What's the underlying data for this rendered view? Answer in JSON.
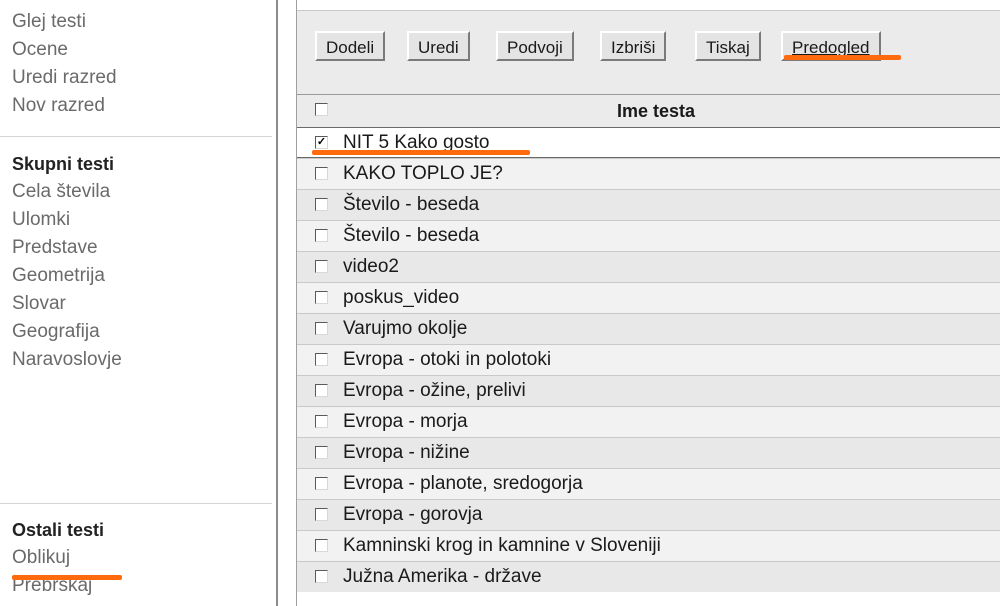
{
  "sidebar": {
    "top_links": [
      "Glej testi",
      "Ocene",
      "Uredi razred",
      "Nov razred"
    ],
    "groups": [
      {
        "heading": "Skupni testi",
        "links": [
          "Cela števila",
          "Ulomki",
          "Predstave",
          "Geometrija",
          "Slovar",
          "Geografija",
          "Naravoslovje"
        ]
      },
      {
        "heading": "Ostali testi",
        "links": [
          "Oblikuj",
          "Prebrskaj"
        ]
      }
    ]
  },
  "toolbar": {
    "buttons": [
      "Dodeli",
      "Uredi",
      "Podvoji",
      "Izbriši",
      "Tiskaj",
      "Predogled"
    ]
  },
  "table": {
    "header": "Ime testa",
    "rows": [
      {
        "name": "NIT 5 Kako gosto",
        "checked": true
      },
      {
        "name": "KAKO TOPLO JE?",
        "checked": false
      },
      {
        "name": "Število - beseda",
        "checked": false
      },
      {
        "name": "Število - beseda",
        "checked": false
      },
      {
        "name": "video2",
        "checked": false
      },
      {
        "name": "poskus_video",
        "checked": false
      },
      {
        "name": "Varujmo okolje",
        "checked": false
      },
      {
        "name": "Evropa - otoki in polotoki",
        "checked": false
      },
      {
        "name": "Evropa - ožine, prelivi",
        "checked": false
      },
      {
        "name": "Evropa - morja",
        "checked": false
      },
      {
        "name": "Evropa - nižine",
        "checked": false
      },
      {
        "name": "Evropa - planote, sredogorja",
        "checked": false
      },
      {
        "name": "Evropa - gorovja",
        "checked": false
      },
      {
        "name": "Kamninski krog in kamnine v Sloveniji",
        "checked": false
      },
      {
        "name": "Južna Amerika - države",
        "checked": false
      }
    ]
  },
  "colors": {
    "annotation": "#ff6a0c",
    "sidebar_link": "#6a6a6a",
    "toolbar_bg": "#ebebeb"
  }
}
